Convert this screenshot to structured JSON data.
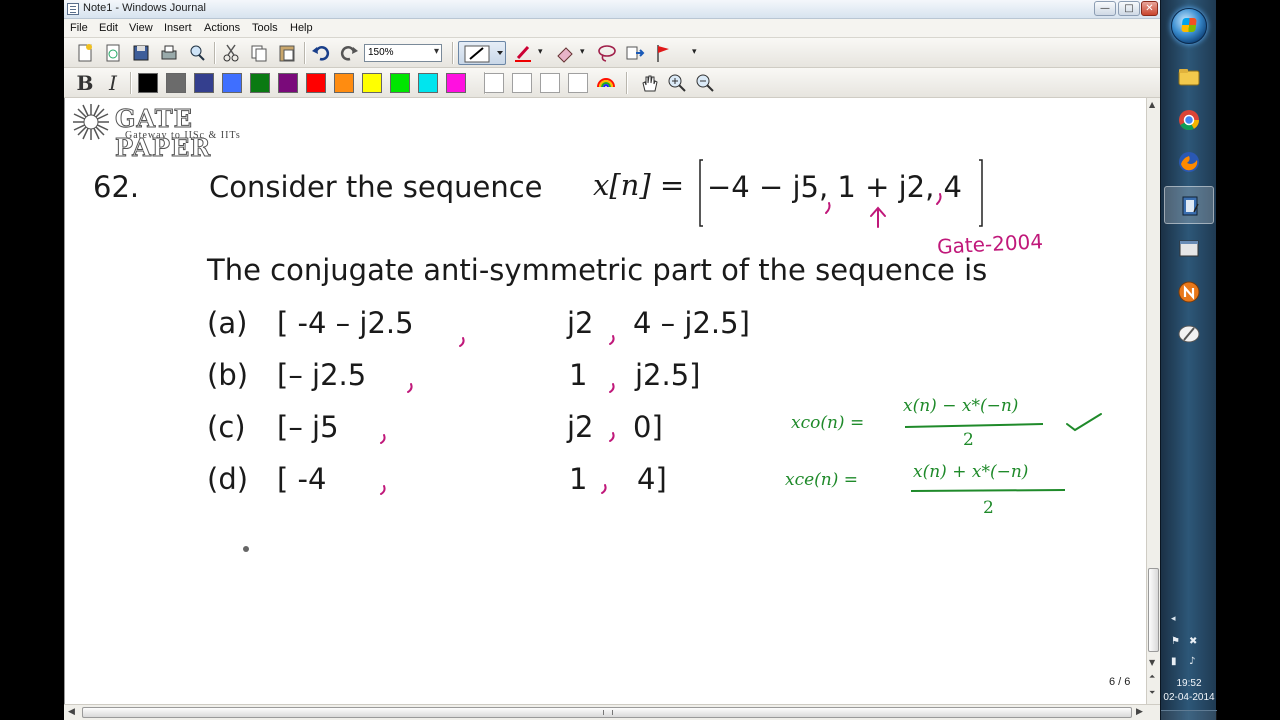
{
  "window": {
    "title": "Note1 - Windows Journal",
    "minimize_glyph": "—",
    "maximize_glyph": "□",
    "close_glyph": "✕"
  },
  "menu": {
    "items": [
      "File",
      "Edit",
      "View",
      "Insert",
      "Actions",
      "Tools",
      "Help"
    ]
  },
  "toolbar": {
    "zoom_value": "150%",
    "colors": [
      "#000000",
      "#6b6b6b",
      "#343f8e",
      "#3f6fff",
      "#0a7a12",
      "#7a0a7a",
      "#ff0000",
      "#ff8c10",
      "#ffff00",
      "#00e600",
      "#00e5ee",
      "#ff10e0"
    ],
    "bold_label": "B",
    "italic_label": "I"
  },
  "logo": {
    "title": "GATE PAPER",
    "subtitle": "Gateway to IISc & IITs"
  },
  "question": {
    "number": "62.",
    "prompt": "Consider the sequence",
    "sequence_lhs": "x[n] =",
    "sequence_terms": "−4 − j5, 1 + j2, 4",
    "statement": "The conjugate anti-symmetric part of the sequence is",
    "options": [
      {
        "label": "(a)",
        "first": "[ -4 – j2.5",
        "second": "j2",
        "third": "4 – j2.5]"
      },
      {
        "label": "(b)",
        "first": "[– j2.5",
        "second": "1",
        "third": "j2.5]"
      },
      {
        "label": "(c)",
        "first": "[– j5",
        "second": "j2",
        "third": "0]"
      },
      {
        "label": "(d)",
        "first": "[ -4",
        "second": "1",
        "third": "4]"
      }
    ]
  },
  "annotations": {
    "source": "Gate-2004",
    "formula_co_lhs": "xco(n) =",
    "formula_co_num": "x(n) − x*(−n)",
    "formula_co_den": "2",
    "formula_ce_lhs": "xce(n) =",
    "formula_ce_num": "x(n) + x*(−n)",
    "formula_ce_den": "2",
    "ink_colors": {
      "pink": "#c0187a",
      "green": "#1f8a2a"
    }
  },
  "status": {
    "page_indicator": "6 / 6"
  },
  "taskbar": {
    "time": "19:52",
    "date": "02-04-2014"
  }
}
